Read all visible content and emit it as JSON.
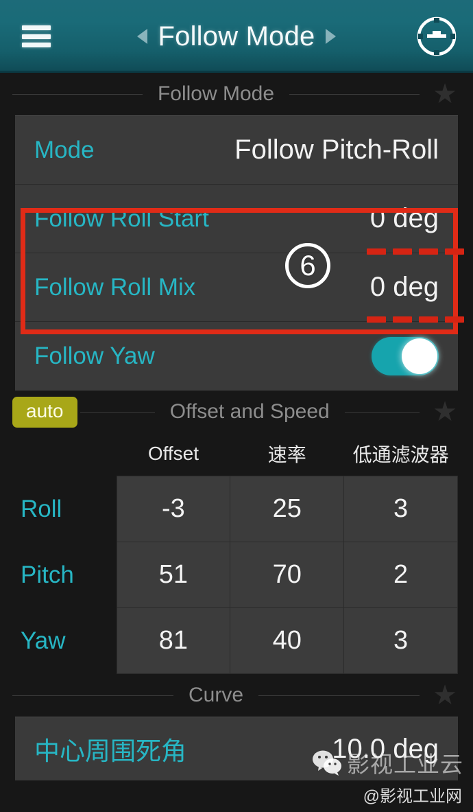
{
  "header": {
    "title": "Follow Mode",
    "menu_icon": "hamburger-menu-icon",
    "prev_icon": "chevron-left-icon",
    "next_icon": "chevron-right-icon",
    "right_icon": "target-reticle-icon",
    "background_color": "#1a6b78"
  },
  "sections": {
    "follow_mode": {
      "label": "Follow Mode",
      "star": "★"
    },
    "offset_speed": {
      "label": "Offset and Speed",
      "auto_label": "auto",
      "star": "★",
      "auto_color": "#a8a718"
    },
    "curve": {
      "label": "Curve",
      "star": "★"
    }
  },
  "follow_rows": [
    {
      "label": "Mode",
      "value": "Follow Pitch-Roll"
    },
    {
      "label": "Follow Roll Start",
      "value": "0 deg"
    },
    {
      "label": "Follow Roll Mix",
      "value": "0 deg"
    }
  ],
  "follow_yaw": {
    "label": "Follow Yaw",
    "toggle_state": "on",
    "toggle_color": "#16a4ad"
  },
  "table": {
    "columns": [
      "Offset",
      "速率",
      "低通滤波器"
    ],
    "rows": [
      {
        "name": "Roll",
        "values": [
          "-3",
          "25",
          "3"
        ]
      },
      {
        "name": "Pitch",
        "values": [
          "51",
          "70",
          "2"
        ]
      },
      {
        "name": "Yaw",
        "values": [
          "81",
          "40",
          "3"
        ]
      }
    ]
  },
  "curve_row": {
    "label": "中心周围死角",
    "value": "10.0 deg"
  },
  "annotation": {
    "step_number": "⑥",
    "step_plain": "6",
    "box_color": "#e02b17",
    "dash_color": "#d62413"
  },
  "watermark": {
    "logo": "wechat-icon",
    "text": "影视工业云",
    "handle": "@影视工业网"
  },
  "colors": {
    "accent_teal": "#27b6c4",
    "panel_bg": "#3a3a3a",
    "page_bg": "#171717"
  }
}
